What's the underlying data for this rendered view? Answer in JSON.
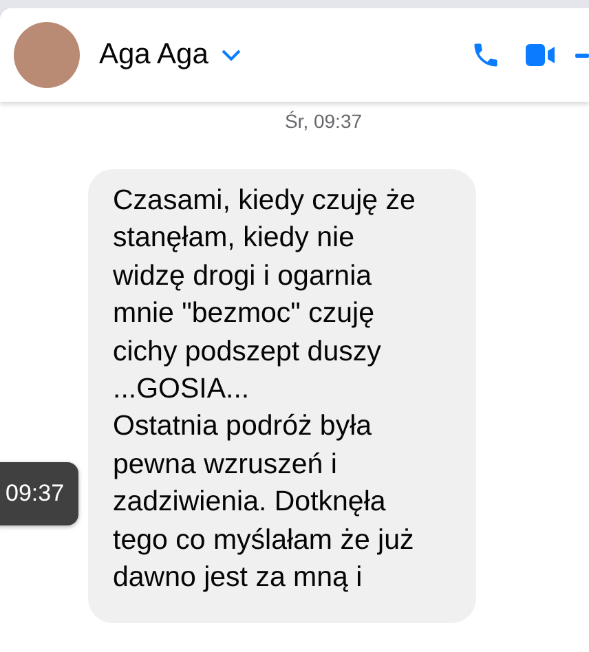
{
  "header": {
    "contact_name": "Aga Aga"
  },
  "timestamp": "Śr, 09:37",
  "message": {
    "lines": [
      "Czasami, kiedy czuję że",
      "stanęłam, kiedy nie",
      "widzę drogi i ogarnia",
      "mnie \"bezmoc\" czuję",
      "cichy podszept duszy",
      "...GOSIA...",
      "Ostatnia podróż była",
      "pewna wzruszeń i",
      "zadziwienia. Dotknęła",
      "tego co myślałam że już",
      "dawno jest za mną i"
    ]
  },
  "tooltip": "09:37"
}
